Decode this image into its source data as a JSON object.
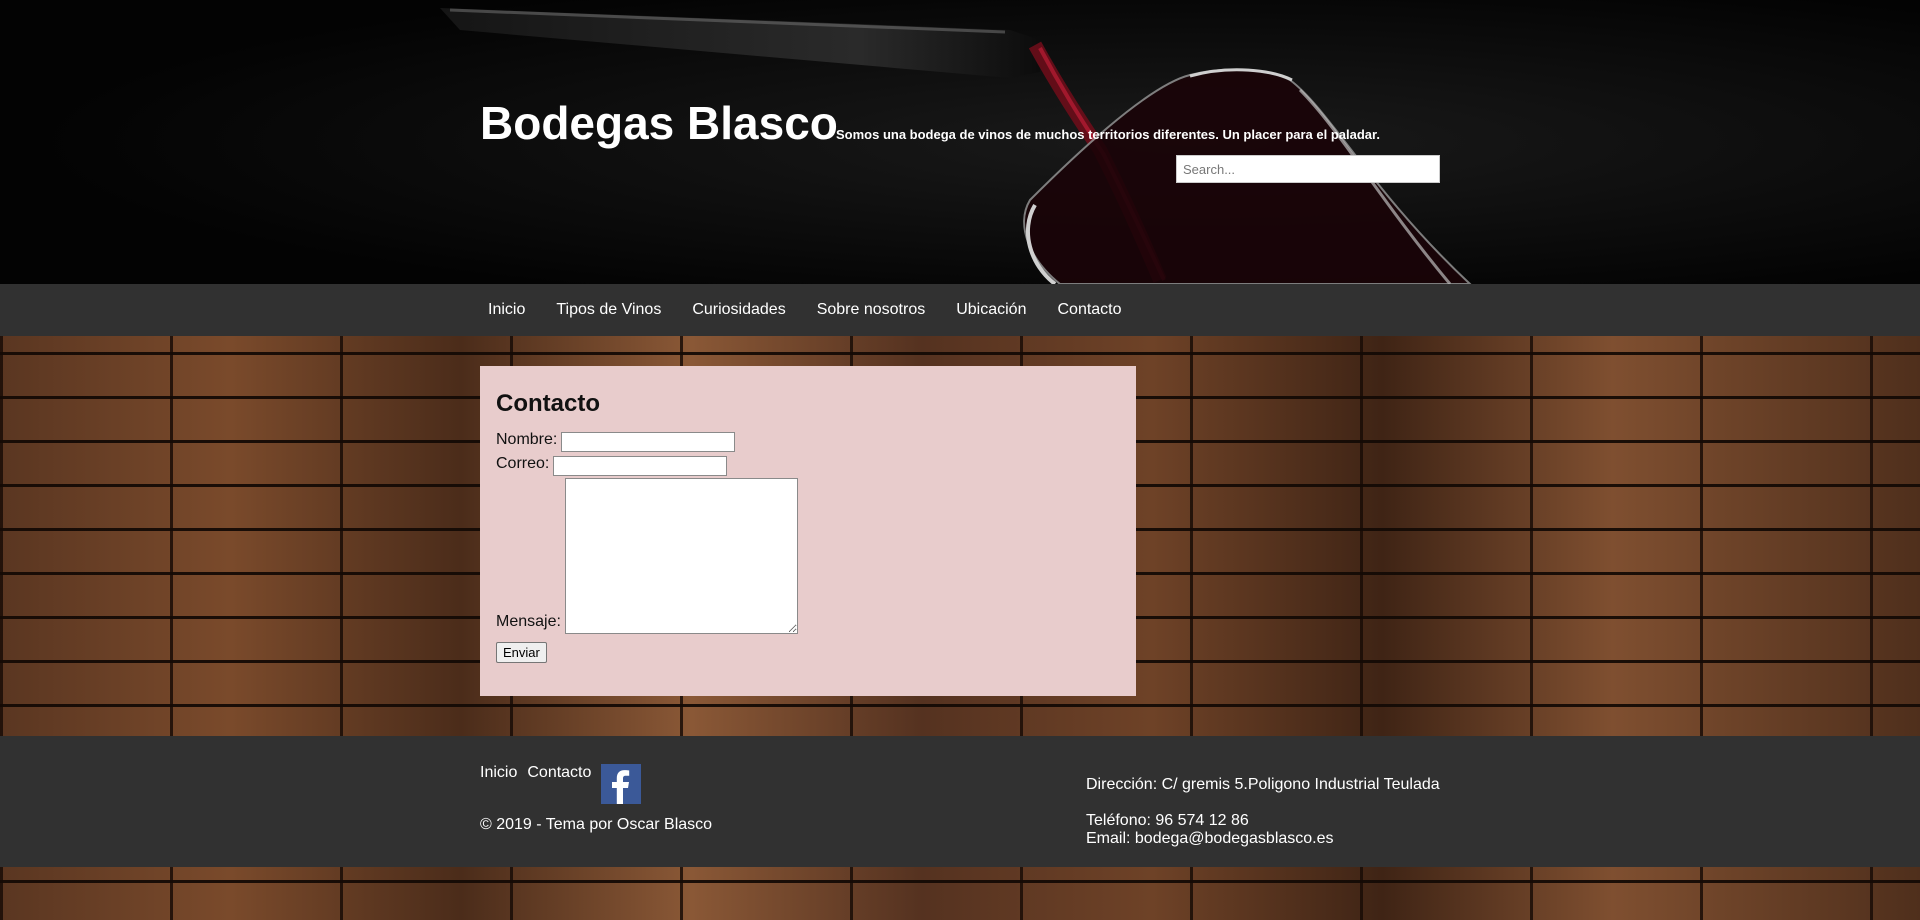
{
  "header": {
    "title": "Bodegas Blasco",
    "tagline": "Somos una bodega de vinos de muchos territorios diferentes. Un placer para el paladar.",
    "search_placeholder": "Search..."
  },
  "nav": {
    "items": [
      "Inicio",
      "Tipos de Vinos",
      "Curiosidades",
      "Sobre nosotros",
      "Ubicación",
      "Contacto"
    ]
  },
  "contact": {
    "title": "Contacto",
    "name_label": "Nombre:",
    "email_label": "Correo:",
    "message_label": "Mensaje:",
    "submit_label": "Enviar"
  },
  "footer": {
    "links": [
      "Inicio",
      "Contacto"
    ],
    "social_icon": "facebook-icon",
    "copyright": "© 2019 - Tema por Oscar Blasco",
    "address": "Dirección: C/ gremis 5.Poligono Industrial Teulada",
    "phone": "Teléfono: 96 574 12 86",
    "email": "Email: bodega@bodegasblasco.es"
  },
  "colors": {
    "header_bg": "#040404",
    "nav_bg": "#313131",
    "content_bg": "#e8cccc",
    "facebook": "#3b5998"
  }
}
